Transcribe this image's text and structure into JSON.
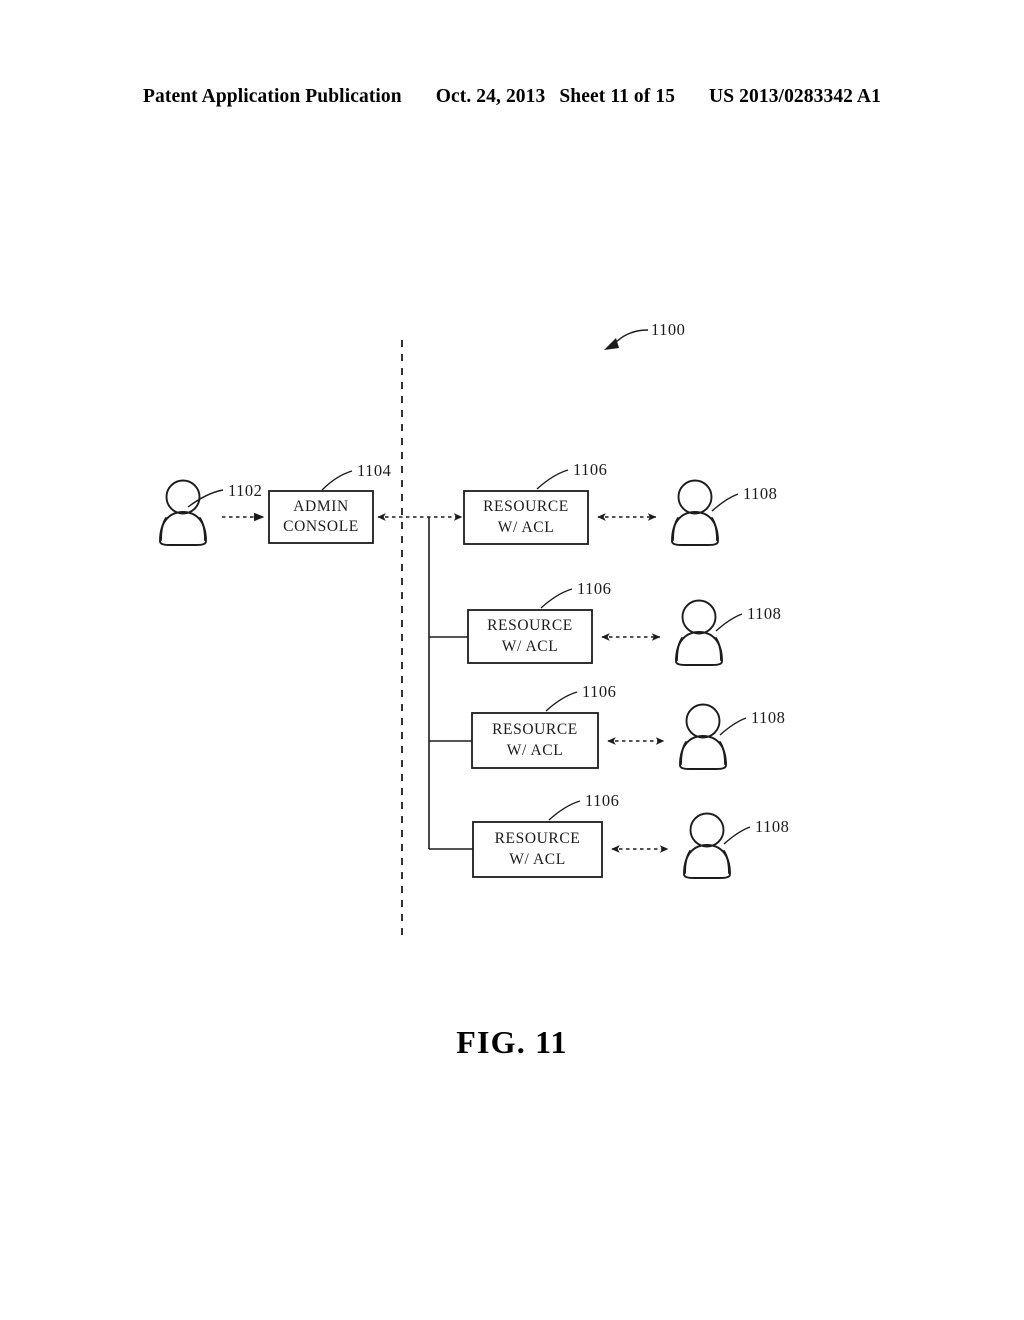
{
  "header": {
    "publication": "Patent Application Publication",
    "date": "Oct. 24, 2013",
    "sheet": "Sheet 11 of 15",
    "patent_number": "US 2013/0283342 A1"
  },
  "figure": {
    "caption": "FIG. 11",
    "system_ref": "1100",
    "admin_user_ref": "1102",
    "admin_console": {
      "ref": "1104",
      "line1": "ADMIN",
      "line2": "CONSOLE"
    },
    "resources": [
      {
        "ref": "1106",
        "line1": "RESOURCE",
        "line2": "W/ ACL",
        "user_ref": "1108"
      },
      {
        "ref": "1106",
        "line1": "RESOURCE",
        "line2": "W/ ACL",
        "user_ref": "1108"
      },
      {
        "ref": "1106",
        "line1": "RESOURCE",
        "line2": "W/ ACL",
        "user_ref": "1108"
      },
      {
        "ref": "1106",
        "line1": "RESOURCE",
        "line2": "W/ ACL",
        "user_ref": "1108"
      }
    ],
    "colors": {
      "ink": "#1c1c1c",
      "background": "#ffffff"
    }
  }
}
